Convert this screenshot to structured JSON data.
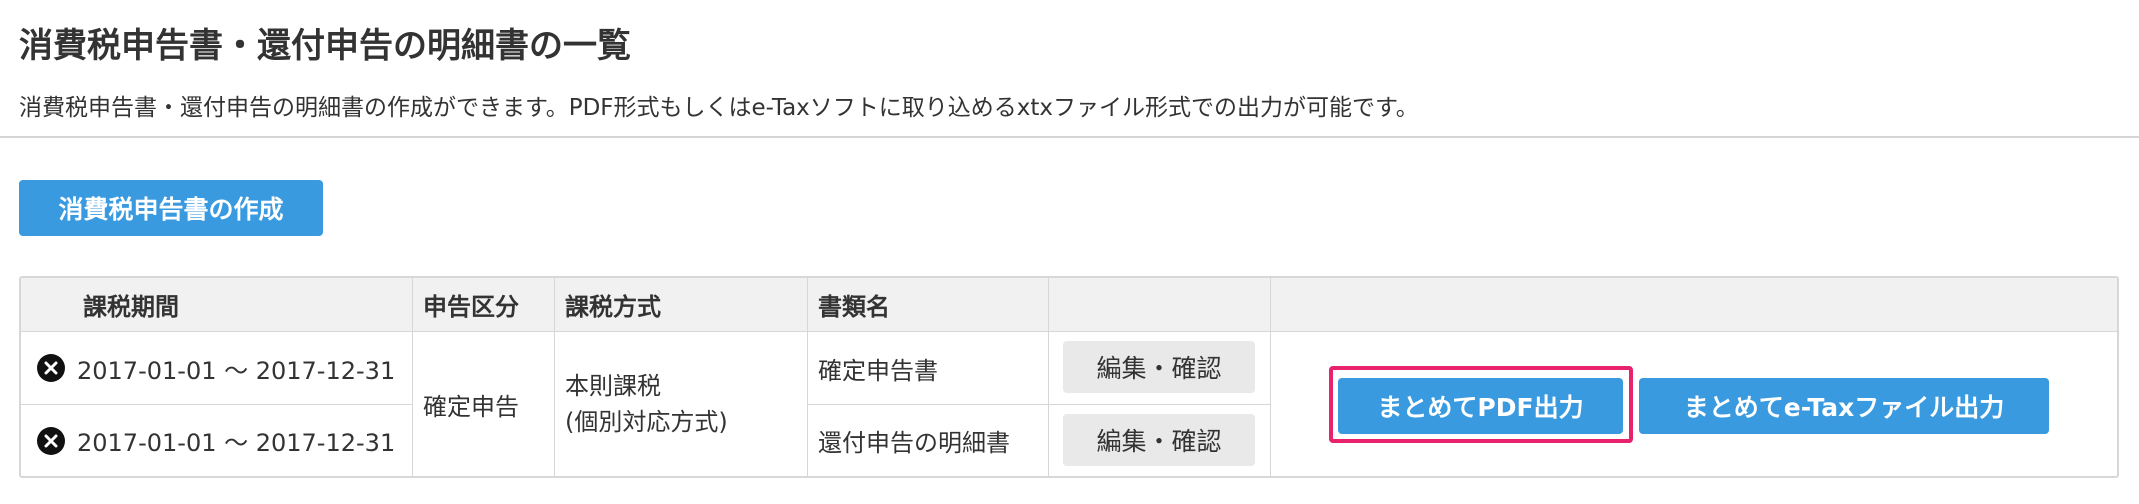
{
  "header": {
    "title": "消費税申告書・還付申告の明細書の一覧",
    "description": "消費税申告書・還付申告の明細書の作成ができます。PDF形式もしくはe-Taxソフトに取り込めるxtxファイル形式での出力が可能です。"
  },
  "actions": {
    "create_label": "消費税申告書の作成"
  },
  "table": {
    "headers": {
      "period": "課税期間",
      "category": "申告区分",
      "method": "課税方式",
      "document": "書類名",
      "edit": "",
      "output": ""
    },
    "rows": [
      {
        "period": "2017-01-01 〜 2017-12-31",
        "document": "確定申告書",
        "edit_label": "編集・確認"
      },
      {
        "period": "2017-01-01 〜 2017-12-31",
        "document": "還付申告の明細書",
        "edit_label": "編集・確認"
      }
    ],
    "category": "確定申告",
    "method_line1": "本則課税",
    "method_line2": "(個別対応方式)",
    "pdf_label": "まとめてPDF出力",
    "etax_label": "まとめてe-Taxファイル出力"
  },
  "icons": {
    "delete": "close-circle-icon"
  },
  "colors": {
    "primary_button": "#3a9ae0",
    "highlight_border": "#e8226c",
    "header_background": "#f1f1f1",
    "edit_button_background": "#e9e9e9"
  }
}
